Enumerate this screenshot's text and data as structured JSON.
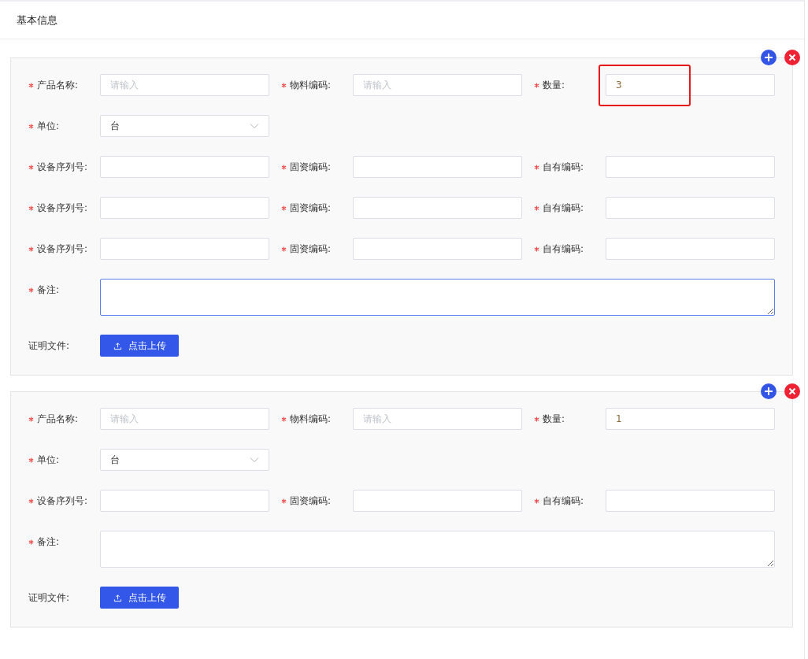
{
  "header": {
    "title": "基本信息"
  },
  "groups": [
    {
      "rows": [
        [
          {
            "kind": "input",
            "label": "产品名称:",
            "required": true,
            "placeholder": "请输入"
          },
          {
            "kind": "input",
            "label": "物料编码:",
            "required": true,
            "placeholder": "请输入"
          },
          {
            "kind": "input",
            "label": "数量:",
            "required": true,
            "value": "3",
            "highlighted": true
          }
        ],
        [
          {
            "kind": "select",
            "label": "单位:",
            "required": true,
            "value": "台"
          }
        ],
        [
          {
            "kind": "input",
            "label": "设备序列号:",
            "required": true
          },
          {
            "kind": "input",
            "label": "固资编码:",
            "required": true
          },
          {
            "kind": "input",
            "label": "自有编码:",
            "required": true
          }
        ],
        [
          {
            "kind": "input",
            "label": "设备序列号:",
            "required": true
          },
          {
            "kind": "input",
            "label": "固资编码:",
            "required": true
          },
          {
            "kind": "input",
            "label": "自有编码:",
            "required": true
          }
        ],
        [
          {
            "kind": "input",
            "label": "设备序列号:",
            "required": true
          },
          {
            "kind": "input",
            "label": "固资编码:",
            "required": true
          },
          {
            "kind": "input",
            "label": "自有编码:",
            "required": true
          }
        ],
        [
          {
            "kind": "textarea",
            "label": "备注:",
            "required": true,
            "focused": true
          }
        ],
        [
          {
            "kind": "upload",
            "label": "证明文件:",
            "required": false,
            "button": "点击上传"
          }
        ]
      ]
    },
    {
      "rows": [
        [
          {
            "kind": "input",
            "label": "产品名称:",
            "required": true,
            "placeholder": "请输入"
          },
          {
            "kind": "input",
            "label": "物料编码:",
            "required": true,
            "placeholder": "请输入"
          },
          {
            "kind": "input",
            "label": "数量:",
            "required": true,
            "value": "1"
          }
        ],
        [
          {
            "kind": "select",
            "label": "单位:",
            "required": true,
            "value": "台"
          }
        ],
        [
          {
            "kind": "input",
            "label": "设备序列号:",
            "required": true
          },
          {
            "kind": "input",
            "label": "固资编码:",
            "required": true
          },
          {
            "kind": "input",
            "label": "自有编码:",
            "required": true
          }
        ],
        [
          {
            "kind": "textarea",
            "label": "备注:",
            "required": true,
            "focused": false
          }
        ],
        [
          {
            "kind": "upload",
            "label": "证明文件:",
            "required": false,
            "button": "点击上传"
          }
        ]
      ]
    }
  ]
}
